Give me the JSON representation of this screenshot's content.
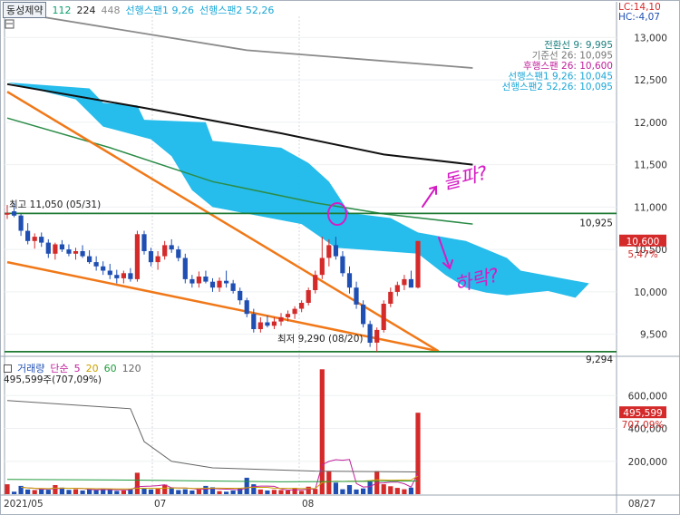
{
  "header": {
    "stock_name": "동성제약",
    "ma_values": [
      "112",
      "224",
      "448"
    ],
    "ma_colors": [
      "#0a9e6f",
      "#222222",
      "#8a8a8a"
    ],
    "ichimoku_label_1": "선행스팬1 9,26",
    "ichimoku_label_2": "선행스팬2 52,26",
    "lc": "LC:14,10",
    "hc": "HC:-4,07"
  },
  "legend": {
    "conversion": "전환선 9: 9,995",
    "base": "기준선 26: 10,095",
    "lagging": "후행스팬 26: 10,600",
    "span1": "선행스팬1 9,26: 10,045",
    "span2": "선행스팬2 52,26: 10,095"
  },
  "annotations": {
    "high": "최고 11,050 (05/31)",
    "low": "최저 9,290 (08/20)",
    "hline_upper": "10,925",
    "hline_lower": "9,294",
    "current_price": "10,600",
    "current_pct": "5,47%",
    "handwritten_up": "돌파?",
    "handwritten_down": "하락?"
  },
  "volume": {
    "title": "거래량",
    "ma_label": "단순",
    "ma_periods": [
      "5",
      "20",
      "60",
      "120"
    ],
    "ma_colors": [
      "#c0219b",
      "#c9a100",
      "#1f9a3c",
      "#666666"
    ],
    "subtitle": "495,599주(707,09%)",
    "current": "495,599",
    "current_pct": "707,09%"
  },
  "colors": {
    "up": "#d42a2a",
    "down": "#1f4fb3",
    "cloud": "#1ab8ea",
    "trendline": "#f07818",
    "hline": "#1f7a32",
    "annotation_pen": "#d51cc4"
  },
  "chart_data": [
    {
      "type": "candlestick",
      "title": "동성제약",
      "x_ticks": [
        "2021/05",
        "07",
        "08",
        "08/27"
      ],
      "y_ticks": [
        9500,
        10000,
        10500,
        11000,
        11500,
        12000,
        12500,
        13000
      ],
      "ylim": [
        9250,
        13250
      ],
      "ohlc": [
        [
          10910,
          10960,
          10860,
          10930
        ],
        [
          10950,
          11050,
          10880,
          10900
        ],
        [
          10900,
          10920,
          10660,
          10720
        ],
        [
          10720,
          10810,
          10560,
          10600
        ],
        [
          10600,
          10690,
          10510,
          10650
        ],
        [
          10650,
          10700,
          10530,
          10580
        ],
        [
          10580,
          10620,
          10400,
          10450
        ],
        [
          10450,
          10580,
          10380,
          10560
        ],
        [
          10560,
          10610,
          10470,
          10500
        ],
        [
          10500,
          10560,
          10420,
          10450
        ],
        [
          10450,
          10520,
          10380,
          10480
        ],
        [
          10480,
          10550,
          10400,
          10420
        ],
        [
          10420,
          10490,
          10330,
          10350
        ],
        [
          10350,
          10420,
          10250,
          10300
        ],
        [
          10300,
          10360,
          10200,
          10250
        ],
        [
          10250,
          10330,
          10150,
          10200
        ],
        [
          10200,
          10260,
          10100,
          10160
        ],
        [
          10160,
          10250,
          10100,
          10220
        ],
        [
          10220,
          10280,
          10120,
          10150
        ],
        [
          10150,
          10720,
          10120,
          10680
        ],
        [
          10680,
          10720,
          10440,
          10480
        ],
        [
          10480,
          10520,
          10300,
          10350
        ],
        [
          10350,
          10480,
          10260,
          10420
        ],
        [
          10420,
          10600,
          10380,
          10550
        ],
        [
          10550,
          10620,
          10460,
          10500
        ],
        [
          10500,
          10540,
          10360,
          10400
        ],
        [
          10400,
          10450,
          10100,
          10150
        ],
        [
          10150,
          10200,
          10050,
          10100
        ],
        [
          10100,
          10240,
          10050,
          10180
        ],
        [
          10180,
          10250,
          10100,
          10120
        ],
        [
          10120,
          10160,
          10000,
          10050
        ],
        [
          10050,
          10170,
          10000,
          10130
        ],
        [
          10130,
          10250,
          10050,
          10100
        ],
        [
          10100,
          10140,
          9980,
          10010
        ],
        [
          10010,
          10050,
          9850,
          9900
        ],
        [
          9900,
          9930,
          9700,
          9740
        ],
        [
          9740,
          9800,
          9520,
          9560
        ],
        [
          9560,
          9700,
          9520,
          9640
        ],
        [
          9640,
          9720,
          9580,
          9600
        ],
        [
          9600,
          9700,
          9560,
          9650
        ],
        [
          9650,
          9750,
          9600,
          9700
        ],
        [
          9700,
          9780,
          9650,
          9740
        ],
        [
          9740,
          9830,
          9680,
          9800
        ],
        [
          9800,
          9900,
          9760,
          9870
        ],
        [
          9870,
          10050,
          9840,
          10020
        ],
        [
          10020,
          10250,
          9980,
          10200
        ],
        [
          10200,
          10650,
          10150,
          10400
        ],
        [
          10400,
          10620,
          10300,
          10550
        ],
        [
          10550,
          10650,
          10380,
          10420
        ],
        [
          10420,
          10480,
          10180,
          10220
        ],
        [
          10220,
          10300,
          9980,
          10050
        ],
        [
          10050,
          10120,
          9800,
          9850
        ],
        [
          9850,
          9900,
          9580,
          9620
        ],
        [
          9620,
          9660,
          9350,
          9400
        ],
        [
          9400,
          9580,
          9290,
          9550
        ],
        [
          9550,
          9900,
          9520,
          9860
        ],
        [
          9860,
          10050,
          9820,
          10000
        ],
        [
          10000,
          10120,
          9950,
          10080
        ],
        [
          10080,
          10200,
          10020,
          10150
        ],
        [
          10150,
          10250,
          10080,
          10050
        ],
        [
          10050,
          10600,
          10040,
          10600
        ]
      ],
      "volume": [
        60000,
        15000,
        50000,
        28000,
        25000,
        30000,
        27000,
        55000,
        40000,
        26000,
        30000,
        22000,
        29000,
        24000,
        35000,
        28000,
        20000,
        22000,
        30000,
        130000,
        36000,
        28000,
        34000,
        58000,
        40000,
        25000,
        30000,
        22000,
        28000,
        50000,
        42000,
        18000,
        15000,
        22000,
        35000,
        100000,
        60000,
        28000,
        22000,
        26000,
        25000,
        22000,
        38000,
        20000,
        45000,
        32000,
        760000,
        140000,
        70000,
        30000,
        55000,
        28000,
        35000,
        80000,
        140000,
        60000,
        48000,
        38000,
        30000,
        40000,
        495599
      ],
      "series": [
        {
          "name": "448",
          "points": [
            [
              0,
              13310
            ],
            [
              35,
              12850
            ],
            [
              68,
              12640
            ]
          ]
        },
        {
          "name": "224",
          "points": [
            [
              0,
              12450
            ],
            [
              20,
              12170
            ],
            [
              40,
              11870
            ],
            [
              55,
              11620
            ],
            [
              68,
              11500
            ]
          ]
        },
        {
          "name": "112",
          "points": [
            [
              0,
              12050
            ],
            [
              15,
              11700
            ],
            [
              30,
              11300
            ],
            [
              45,
              11050
            ],
            [
              55,
              10920
            ],
            [
              68,
              10800
            ]
          ]
        },
        {
          "name": "추세선 상단",
          "points": [
            [
              0,
              12360
            ],
            [
              63,
              9300
            ]
          ]
        },
        {
          "name": "추세선 하단",
          "points": [
            [
              0,
              10350
            ],
            [
              63,
              9300
            ]
          ]
        }
      ],
      "cloud_upper": [
        [
          0,
          12470
        ],
        [
          12,
          12400
        ],
        [
          14,
          12230
        ],
        [
          19,
          12200
        ],
        [
          20,
          12030
        ],
        [
          29,
          12000
        ],
        [
          30,
          11780
        ],
        [
          40,
          11700
        ],
        [
          44,
          11520
        ],
        [
          47,
          11300
        ],
        [
          50,
          10930
        ],
        [
          56,
          10870
        ],
        [
          60,
          10700
        ],
        [
          67,
          10600
        ],
        [
          73,
          10400
        ],
        [
          75,
          10250
        ],
        [
          85,
          10100
        ]
      ],
      "cloud_lower": [
        [
          0,
          12470
        ],
        [
          10,
          12270
        ],
        [
          14,
          11950
        ],
        [
          21,
          11800
        ],
        [
          24,
          11600
        ],
        [
          27,
          11200
        ],
        [
          30,
          11000
        ],
        [
          43,
          10800
        ],
        [
          48,
          10520
        ],
        [
          60,
          10450
        ],
        [
          64,
          10200
        ],
        [
          67,
          10050
        ],
        [
          70,
          9990
        ],
        [
          73,
          9960
        ],
        [
          79,
          10010
        ],
        [
          83,
          9930
        ]
      ],
      "hlines": [
        10925,
        9294
      ],
      "annotations": [
        "최고 11,050 (05/31)",
        "최저 9,290 (08/20)"
      ]
    }
  ]
}
